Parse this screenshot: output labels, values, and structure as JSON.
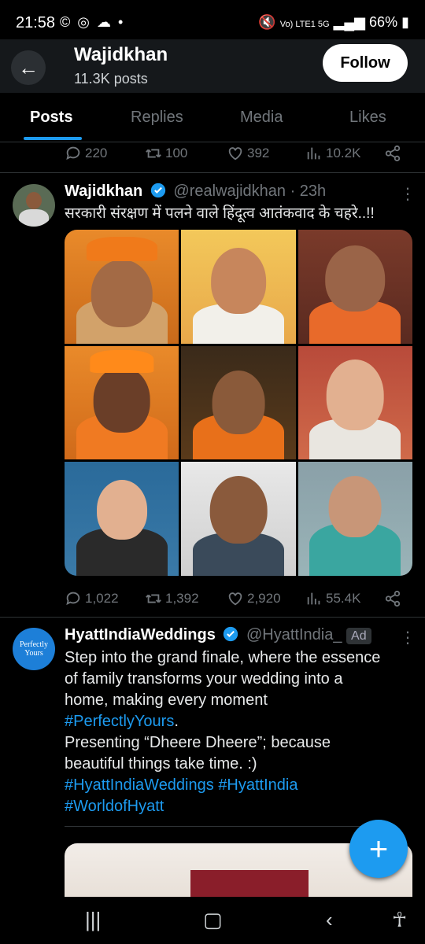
{
  "status_bar": {
    "time": "21:58",
    "left_icons": "© ◎ ☁ •",
    "network": "Vo) LTE1 5G",
    "battery": "66%"
  },
  "header": {
    "title": "Wajidkhan",
    "post_count": "11.3K posts",
    "follow_label": "Follow"
  },
  "tabs": [
    {
      "label": "Posts",
      "active": true
    },
    {
      "label": "Replies",
      "active": false
    },
    {
      "label": "Media",
      "active": false
    },
    {
      "label": "Likes",
      "active": false
    }
  ],
  "prev_actions": {
    "replies": "220",
    "reposts": "100",
    "likes": "392",
    "views": "10.2K"
  },
  "tweet1": {
    "name": "Wajidkhan",
    "handle": "@realwajidkhan",
    "time": "· 23h",
    "text": "सरकारी संरक्षण में पलने वाले हिंदूत्व आतंकवाद के चहरे..!!",
    "actions": {
      "replies": "1,022",
      "reposts": "1,392",
      "likes": "2,920",
      "views": "55.4K"
    }
  },
  "tweet2": {
    "name": "HyattIndiaWeddings",
    "handle": "@HyattIndia_",
    "ad_label": "Ad",
    "avatar_text": "Perfectly Yours",
    "line1": "Step into the grand finale, where the essence",
    "line2": "of family transforms your wedding into a",
    "line3": "home, making every moment",
    "hashtag1": "#PerfectlyYours",
    "line4_suffix": ".",
    "line5": "Presenting “Dheere Dheere”; because",
    "line6": "beautiful things take time. :)",
    "hashtag2": "#HyattIndiaWeddings",
    "hashtag3": "#HyattIndia",
    "hashtag4": "#WorldofHyatt"
  },
  "fab_icon": "+",
  "colors": {
    "accent": "#1d9bf0",
    "background": "#000000",
    "header": "#15181b",
    "muted": "#71767b"
  }
}
